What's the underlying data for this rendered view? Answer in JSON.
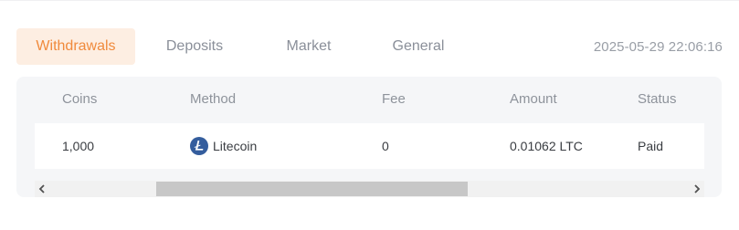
{
  "tabs": [
    {
      "label": "Withdrawals",
      "active": true
    },
    {
      "label": "Deposits",
      "active": false
    },
    {
      "label": "Market",
      "active": false
    },
    {
      "label": "General",
      "active": false
    }
  ],
  "timestamp": "2025-05-29 22:06:16",
  "table": {
    "headers": [
      "Coins",
      "Method",
      "Fee",
      "Amount",
      "Status"
    ],
    "rows": [
      {
        "coins": "1,000",
        "method": "Litecoin",
        "method_icon": "litecoin-icon",
        "fee": "0",
        "amount": "0.01062 LTC",
        "status": "Paid"
      }
    ]
  },
  "colors": {
    "accent": "#f08a3c",
    "accent_bg": "#fdeee2",
    "litecoin": "#345d9d"
  },
  "scrollbar": {
    "left_icon": "chevron-left-icon",
    "right_icon": "chevron-right-icon"
  }
}
